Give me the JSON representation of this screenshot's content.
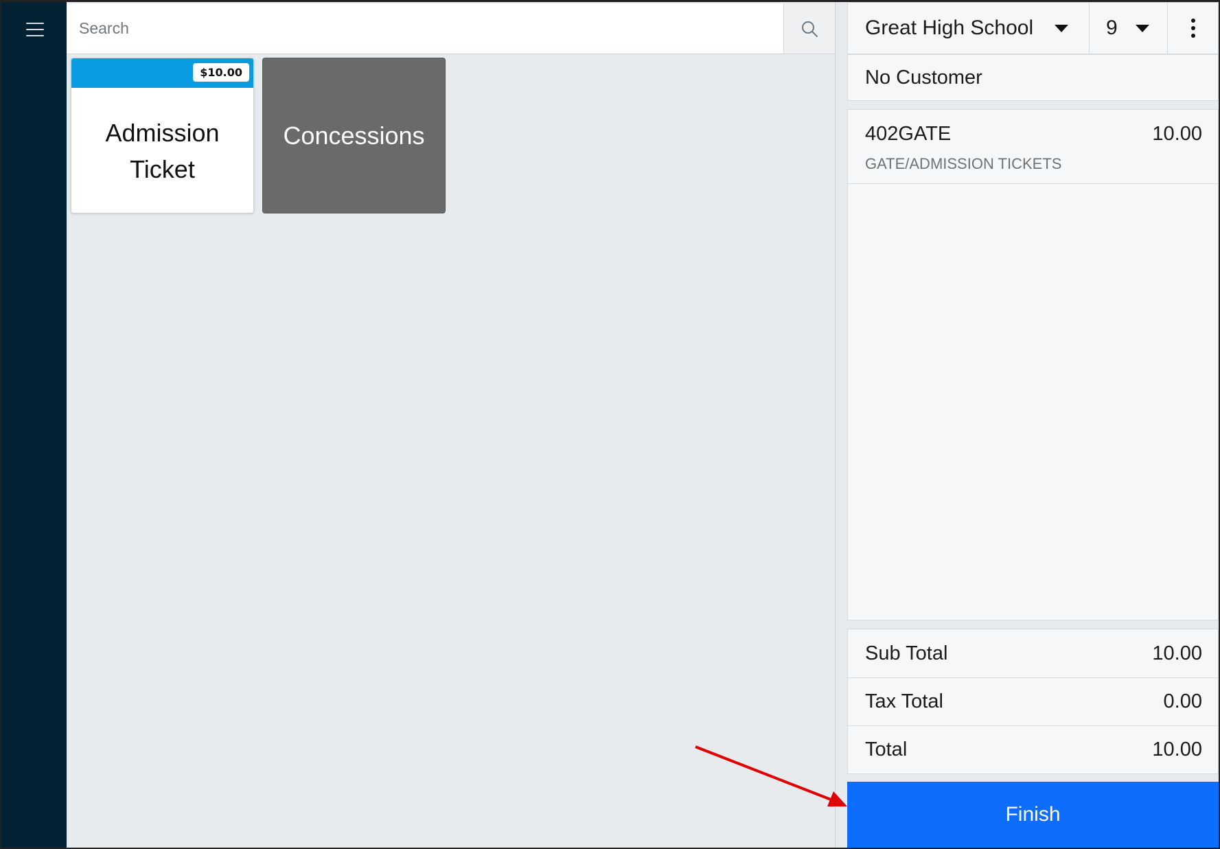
{
  "search": {
    "placeholder": "Search"
  },
  "products": [
    {
      "label": "Admission Ticket",
      "price": "$10.00",
      "head_color": "#0a9be0"
    },
    {
      "label": "Concessions",
      "color": "#6a6a6a"
    }
  ],
  "header": {
    "location": "Great High School",
    "number": "9"
  },
  "customer": {
    "label": "No Customer"
  },
  "order": {
    "items": [
      {
        "code": "402GATE",
        "amount": "10.00",
        "category": "GATE/ADMISSION TICKETS"
      }
    ]
  },
  "totals": [
    {
      "label": "Sub Total",
      "value": "10.00"
    },
    {
      "label": "Tax Total",
      "value": "0.00"
    },
    {
      "label": "Total",
      "value": "10.00"
    }
  ],
  "actions": {
    "finish_label": "Finish",
    "finish_color": "#0d6efd"
  },
  "icons": {
    "menu": "menu-icon",
    "search": "search-icon",
    "caret": "caret-down-icon",
    "more": "more-vertical-icon"
  },
  "colors": {
    "sidebar": "#022234",
    "annotation_arrow": "#e00000"
  }
}
